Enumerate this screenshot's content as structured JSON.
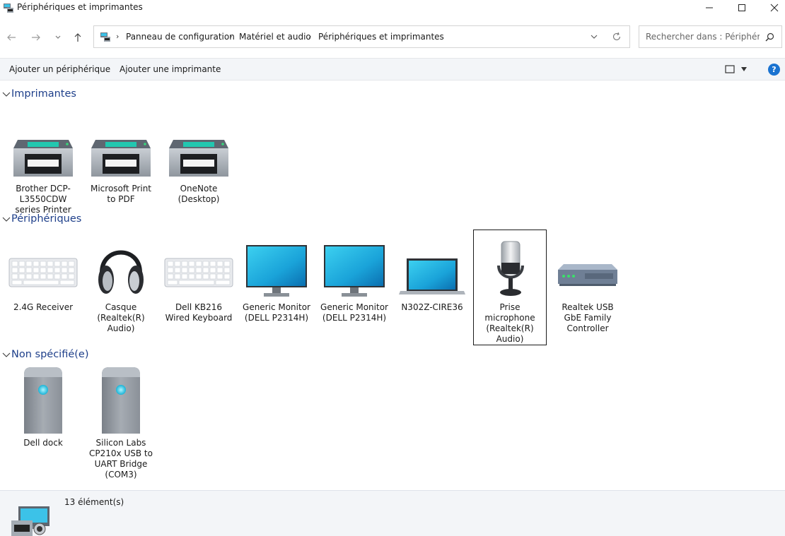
{
  "window": {
    "title": "Périphériques et imprimantes",
    "icon": "devices-printers-icon"
  },
  "nav": {
    "back_icon": "arrow-left-icon",
    "forward_icon": "arrow-right-icon",
    "recent_icon": "chevron-down-icon",
    "up_icon": "arrow-up-icon"
  },
  "address": {
    "breadcrumbs": [
      "Panneau de configuration",
      "Matériel et audio",
      "Périphériques et imprimantes"
    ]
  },
  "search": {
    "placeholder": "Rechercher dans : Périphéri..."
  },
  "commands": {
    "add_device": "Ajouter un périphérique",
    "add_printer": "Ajouter une imprimante"
  },
  "groups": {
    "printers": {
      "title": "Imprimantes",
      "items": [
        {
          "label": "Brother DCP-L3550CDW series Printer",
          "icon": "printer-icon"
        },
        {
          "label": "Microsoft Print to PDF",
          "icon": "printer-icon"
        },
        {
          "label": "OneNote (Desktop)",
          "icon": "printer-icon"
        }
      ]
    },
    "devices": {
      "title": "Périphériques",
      "items": [
        {
          "label": "2.4G Receiver",
          "icon": "keyboard-icon"
        },
        {
          "label": "Casque (Realtek(R) Audio)",
          "icon": "headphones-icon"
        },
        {
          "label": "Dell KB216 Wired Keyboard",
          "icon": "keyboard-icon"
        },
        {
          "label": "Generic Monitor (DELL P2314H)",
          "icon": "monitor-icon"
        },
        {
          "label": "Generic Monitor (DELL P2314H)",
          "icon": "monitor-icon"
        },
        {
          "label": "N302Z-CIRE36",
          "icon": "laptop-icon"
        },
        {
          "label": "Prise microphone (Realtek(R) Audio)",
          "icon": "microphone-icon"
        },
        {
          "label": "Realtek USB GbE Family Controller",
          "icon": "network-adapter-icon"
        }
      ]
    },
    "unspecified": {
      "title": "Non spécifié(e)",
      "items": [
        {
          "label": "Dell dock",
          "icon": "device-tower-icon"
        },
        {
          "label": "Silicon Labs CP210x USB to UART Bridge (COM3)",
          "icon": "device-tower-icon"
        }
      ]
    }
  },
  "status": {
    "count": "13 élément(s)"
  },
  "colors": {
    "group_title": "#1e3f8a",
    "help_blue": "#1a73d1",
    "bar_bg": "#f3f5f8",
    "monitor_screen": "#1aa3d9"
  }
}
